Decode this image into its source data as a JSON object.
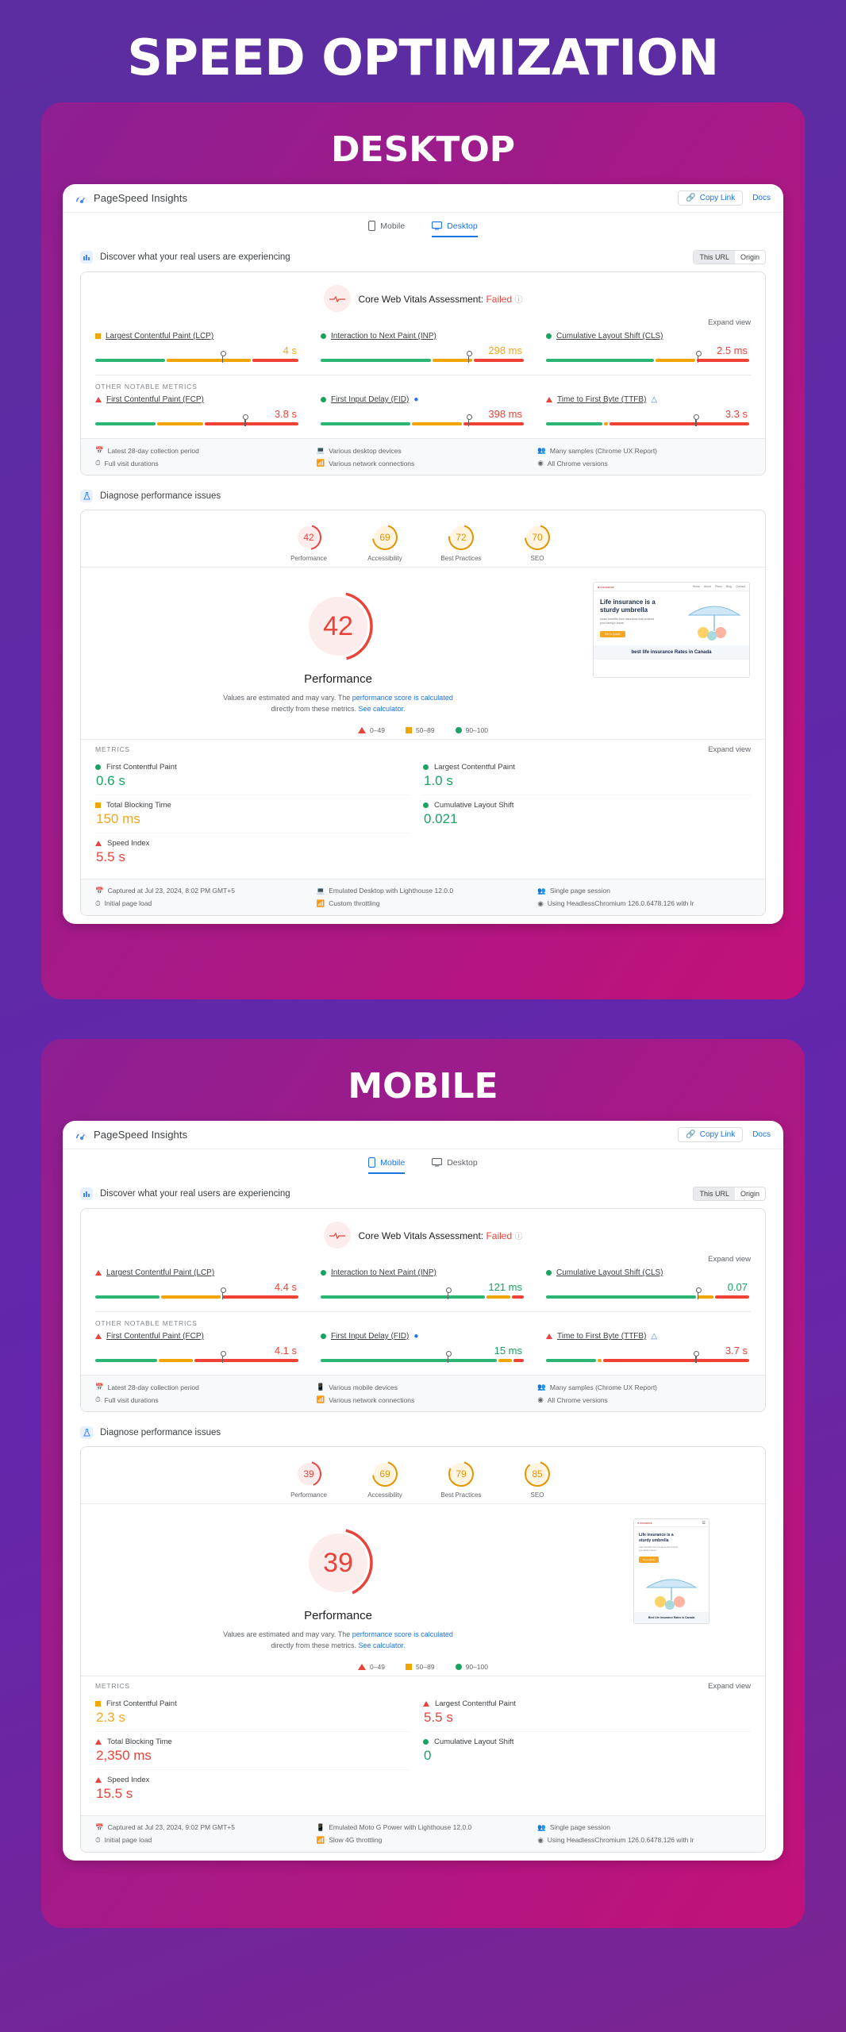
{
  "poster": {
    "title": "SPEED OPTIMIZATION",
    "bg_gradient_start": "#5b2da0",
    "bg_gradient_end": "#7b2490",
    "card_gradient_start": "#8e1f92",
    "card_gradient_end": "#c2117a"
  },
  "sections": [
    {
      "label": "DESKTOP",
      "report": {
        "brand": "PageSpeed Insights",
        "copy_link": "Copy Link",
        "docs": "Docs",
        "tabs": [
          {
            "label": "Mobile",
            "active": false
          },
          {
            "label": "Desktop",
            "active": true
          }
        ],
        "field": {
          "heading": "Discover what your real users are experiencing",
          "toggle": {
            "this_url": "This URL",
            "origin": "Origin",
            "selected": "This URL"
          },
          "assessment_label": "Core Web Vitals Assessment:",
          "assessment_value": "Failed",
          "expand_view": "Expand view",
          "core_metrics": [
            {
              "name": "Largest Contentful Paint (LCP)",
              "value": "4 s",
              "status": "orange",
              "needle_pct": 62
            },
            {
              "name": "Interaction to Next Paint (INP)",
              "value": "298 ms",
              "status": "orange",
              "needle_pct": 72
            },
            {
              "name": "Cumulative Layout Shift (CLS)",
              "value": "2.5 ms",
              "status": "red",
              "needle_pct": 74
            }
          ],
          "other_label": "OTHER NOTABLE METRICS",
          "other_metrics": [
            {
              "name": "First Contentful Paint (FCP)",
              "value": "3.8 s",
              "status": "red",
              "needle_pct": 73
            },
            {
              "name": "First Input Delay (FID)",
              "value": "398 ms",
              "status": "red",
              "needle_pct": 72
            },
            {
              "name": "Time to First Byte (TTFB)",
              "value": "3.3 s",
              "status": "red",
              "needle_pct": 73
            }
          ],
          "info": [
            "Latest 28-day collection period",
            "Various desktop devices",
            "Many samples (Chrome UX Report)",
            "Full visit durations",
            "Various network connections",
            "All Chrome versions"
          ],
          "info_link_text": "Chrome UX Report"
        },
        "lab": {
          "heading": "Diagnose performance issues",
          "gauges": [
            {
              "score": "42",
              "label": "Performance",
              "status": "red"
            },
            {
              "score": "69",
              "label": "Accessibility",
              "status": "orange"
            },
            {
              "score": "72",
              "label": "Best Practices",
              "status": "orange"
            },
            {
              "score": "70",
              "label": "SEO",
              "status": "orange"
            }
          ],
          "hero_score": "42",
          "hero_label": "Performance",
          "hero_note_1": "Values are estimated and may vary. The",
          "hero_note_link_1": "performance score is calculated",
          "hero_note_2": "directly from these metrics.",
          "hero_note_link_2": "See calculator.",
          "legend": [
            {
              "range": "0–49",
              "status": "red"
            },
            {
              "range": "50–89",
              "status": "orange"
            },
            {
              "range": "90–100",
              "status": "green"
            }
          ],
          "metrics_label": "METRICS",
          "expand_view": "Expand view",
          "metrics": [
            {
              "name": "First Contentful Paint",
              "value": "0.6 s",
              "status": "green"
            },
            {
              "name": "Largest Contentful Paint",
              "value": "1.0 s",
              "status": "green"
            },
            {
              "name": "Total Blocking Time",
              "value": "150 ms",
              "status": "orange"
            },
            {
              "name": "Cumulative Layout Shift",
              "value": "0.021",
              "status": "green"
            },
            {
              "name": "Speed Index",
              "value": "5.5 s",
              "status": "red"
            }
          ],
          "thumbnail": {
            "kind": "desktop",
            "headline_1": "Life insurance is a",
            "headline_2": "sturdy umbrella",
            "sub_1": "Learn benefits from insurance that protects",
            "sub_2": "your family's future.",
            "cta": "Get a Quote",
            "banner": "best life insurance Rates in Canada"
          },
          "info": [
            "Captured at Jul 23, 2024, 8:02 PM GMT+5",
            "Emulated Desktop with Lighthouse 12.0.0",
            "Single page session",
            "Initial page load",
            "Custom throttling",
            "Using HeadlessChromium 126.0.6478.126 with lr"
          ]
        }
      }
    },
    {
      "label": "MOBILE",
      "report": {
        "brand": "PageSpeed Insights",
        "copy_link": "Copy Link",
        "docs": "Docs",
        "tabs": [
          {
            "label": "Mobile",
            "active": true
          },
          {
            "label": "Desktop",
            "active": false
          }
        ],
        "field": {
          "heading": "Discover what your real users are experiencing",
          "toggle": {
            "this_url": "This URL",
            "origin": "Origin",
            "selected": "This URL"
          },
          "assessment_label": "Core Web Vitals Assessment:",
          "assessment_value": "Failed",
          "expand_view": "Expand view",
          "core_metrics": [
            {
              "name": "Largest Contentful Paint (LCP)",
              "value": "4.4 s",
              "status": "red",
              "needle_pct": 62
            },
            {
              "name": "Interaction to Next Paint (INP)",
              "value": "121 ms",
              "status": "green",
              "needle_pct": 62
            },
            {
              "name": "Cumulative Layout Shift (CLS)",
              "value": "0.07",
              "status": "green",
              "needle_pct": 74
            }
          ],
          "other_label": "OTHER NOTABLE METRICS",
          "other_metrics": [
            {
              "name": "First Contentful Paint (FCP)",
              "value": "4.1 s",
              "status": "red",
              "needle_pct": 62
            },
            {
              "name": "First Input Delay (FID)",
              "value": "15 ms",
              "status": "green",
              "needle_pct": 62
            },
            {
              "name": "Time to First Byte (TTFB)",
              "value": "3.7 s",
              "status": "red",
              "needle_pct": 73
            }
          ],
          "info": [
            "Latest 28-day collection period",
            "Various mobile devices",
            "Many samples (Chrome UX Report)",
            "Full visit durations",
            "Various network connections",
            "All Chrome versions"
          ],
          "info_link_text": "Chrome UX Report"
        },
        "lab": {
          "heading": "Diagnose performance issues",
          "gauges": [
            {
              "score": "39",
              "label": "Performance",
              "status": "red"
            },
            {
              "score": "69",
              "label": "Accessibility",
              "status": "orange"
            },
            {
              "score": "79",
              "label": "Best Practices",
              "status": "orange"
            },
            {
              "score": "85",
              "label": "SEO",
              "status": "orange"
            }
          ],
          "hero_score": "39",
          "hero_label": "Performance",
          "hero_note_1": "Values are estimated and may vary. The",
          "hero_note_link_1": "performance score is calculated",
          "hero_note_2": "directly from these metrics.",
          "hero_note_link_2": "See calculator.",
          "legend": [
            {
              "range": "0–49",
              "status": "red"
            },
            {
              "range": "50–89",
              "status": "orange"
            },
            {
              "range": "90–100",
              "status": "green"
            }
          ],
          "metrics_label": "METRICS",
          "expand_view": "Expand view",
          "metrics": [
            {
              "name": "First Contentful Paint",
              "value": "2.3 s",
              "status": "orange"
            },
            {
              "name": "Largest Contentful Paint",
              "value": "5.5 s",
              "status": "red"
            },
            {
              "name": "Total Blocking Time",
              "value": "2,350 ms",
              "status": "red"
            },
            {
              "name": "Cumulative Layout Shift",
              "value": "0",
              "status": "green"
            },
            {
              "name": "Speed Index",
              "value": "15.5 s",
              "status": "red"
            }
          ],
          "thumbnail": {
            "kind": "mobile",
            "headline_1": "Life insurance is a",
            "headline_2": "sturdy umbrella",
            "sub_1": "Learn benefits from insurance that protects",
            "sub_2": "your family's future.",
            "cta": "Get a Quote",
            "banner": "Best Life Insurance Rates in Canada"
          },
          "info": [
            "Captured at Jul 23, 2024, 9:02 PM GMT+5",
            "Emulated Moto G Power with Lighthouse 12.0.0",
            "Single page session",
            "Initial page load",
            "Slow 4G throttling",
            "Using HeadlessChromium 126.0.6478.126 with lr"
          ]
        }
      }
    }
  ]
}
